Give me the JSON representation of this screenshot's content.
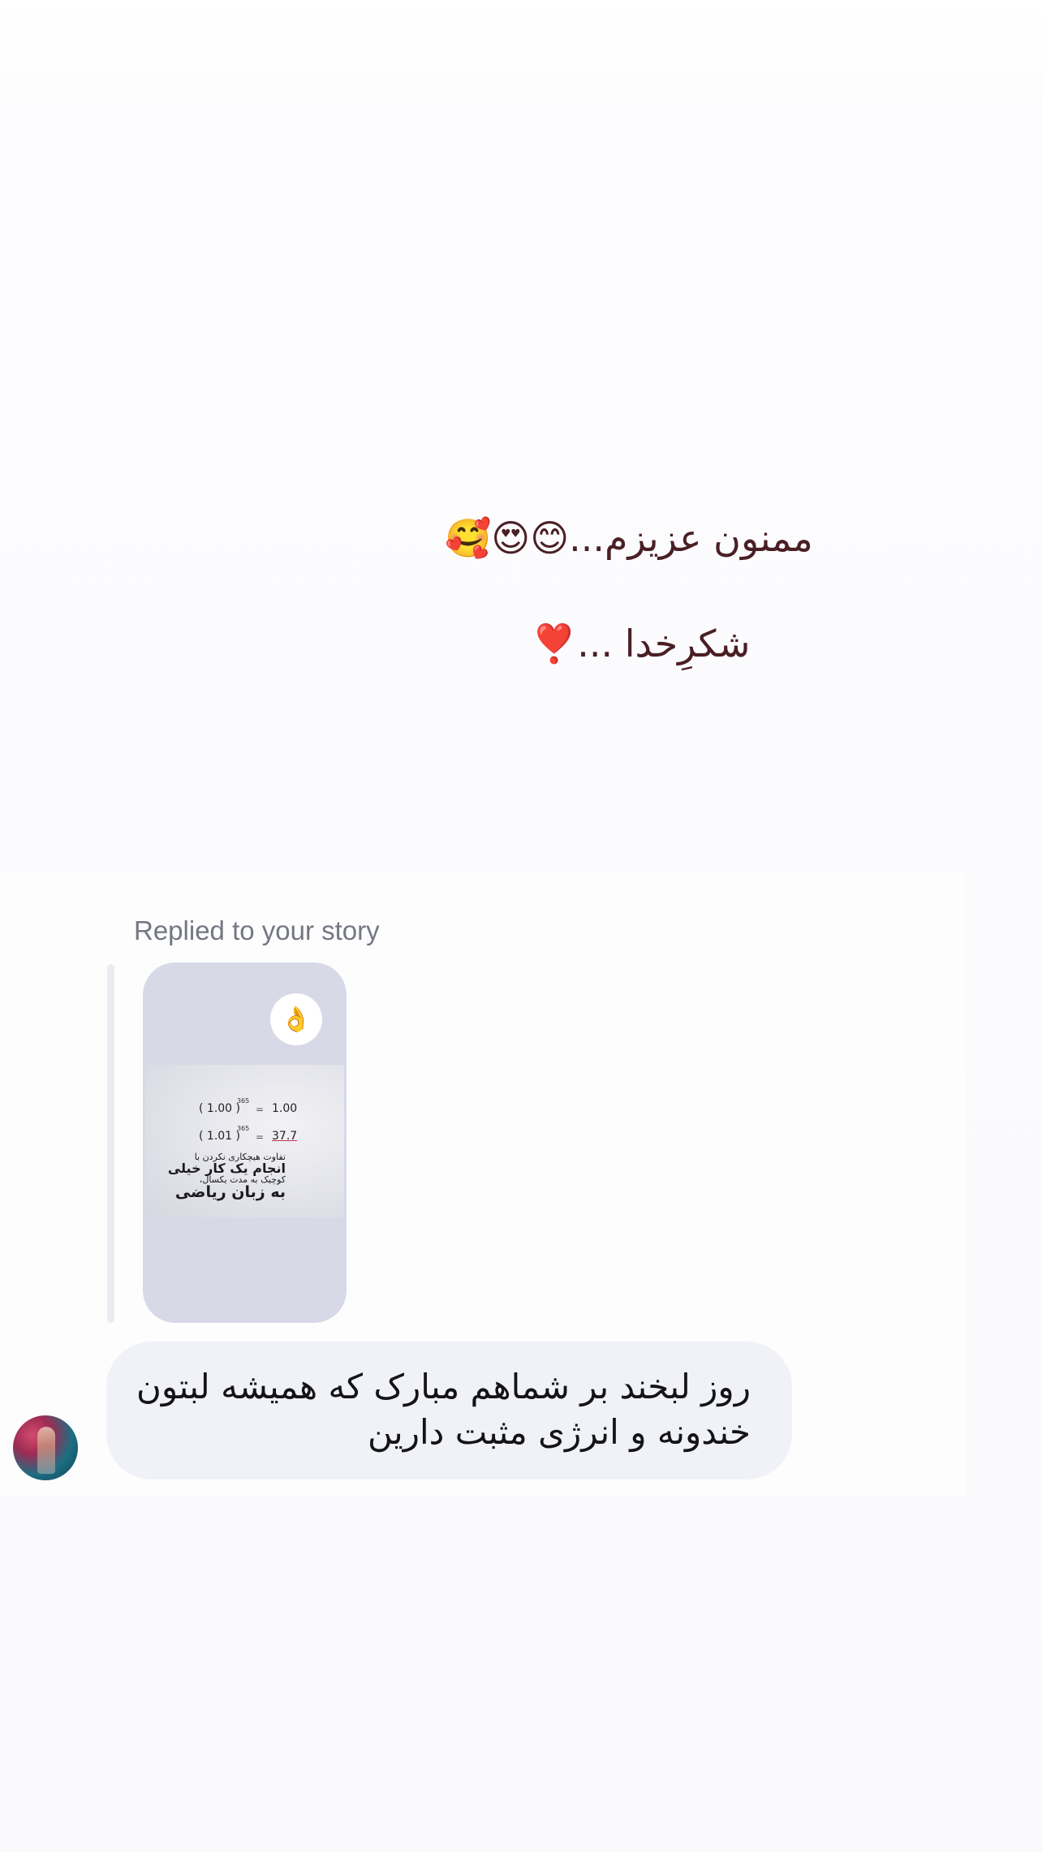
{
  "quote": {
    "line1": "ممنون عزیزم...😊😍🥰",
    "line2": "شکرِخدا ...❣️"
  },
  "message": {
    "reply_label": "Replied to your story",
    "story": {
      "reaction_emoji": "👌",
      "math_row1_base": "( 1.00 )",
      "math_row1_exp": "365",
      "math_row1_eq": "=",
      "math_row1_result": "1.00",
      "math_row2_base": "( 1.01 )",
      "math_row2_exp": "365",
      "math_row2_eq": "=",
      "math_row2_result": "37.7",
      "caption_line1": "تفاوت هیچکاری نکردن با",
      "caption_line2": "انجام یک کار خیلی",
      "caption_line3": "کوچیک به مدت یکسال،",
      "caption_line4": "به زبان ریاضی"
    },
    "text": "روز لبخند بر شماهم مبارک که همیشه لبتون خندونه و انرژی مثبت دارین"
  },
  "colors": {
    "quote_text": "#4a1f24",
    "bubble_bg": "#f0f2f8",
    "story_bg": "#d8d9e7",
    "reply_label": "#737782"
  }
}
